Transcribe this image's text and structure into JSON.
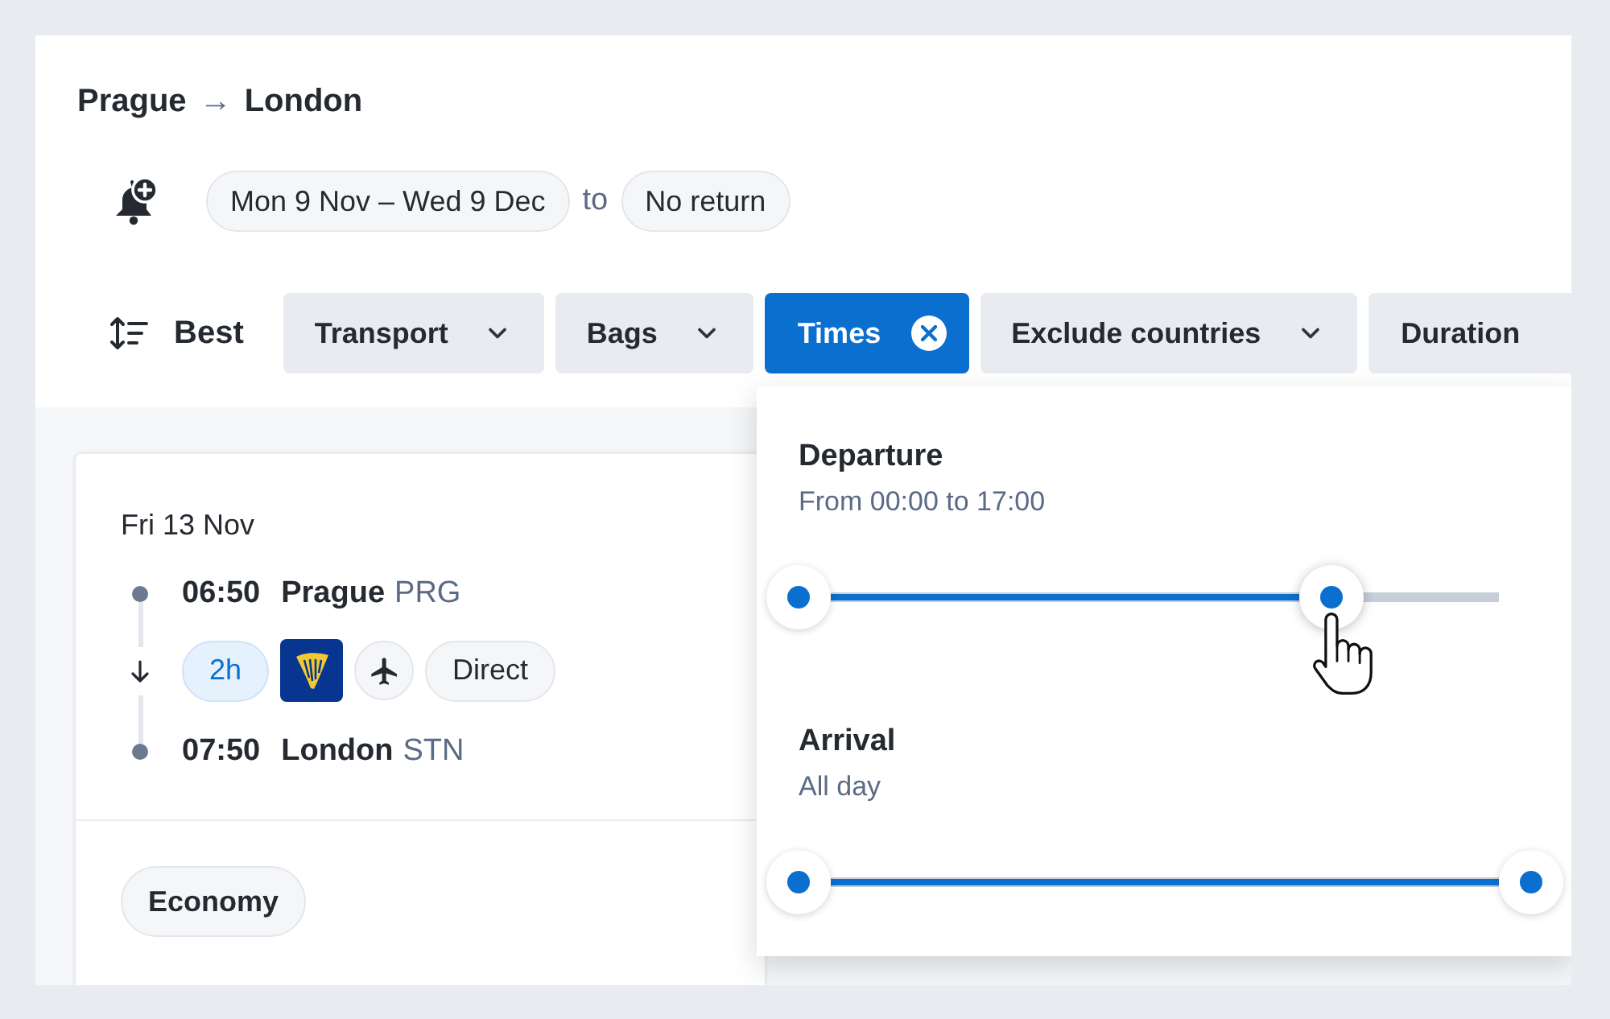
{
  "route": {
    "from": "Prague",
    "arrow": "→",
    "to": "London"
  },
  "dates": {
    "departure": "Mon 9 Nov – Wed 9 Dec",
    "connector": "to",
    "return": "No return"
  },
  "sort": {
    "label": "Best"
  },
  "filters": [
    {
      "label": "Transport",
      "kind": "dropdown",
      "selected": false
    },
    {
      "label": "Bags",
      "kind": "dropdown",
      "selected": false
    },
    {
      "label": "Times",
      "kind": "clearable",
      "selected": true
    },
    {
      "label": "Exclude countries",
      "kind": "dropdown",
      "selected": false
    },
    {
      "label": "Duration",
      "kind": "plain",
      "selected": false
    }
  ],
  "time_popup": {
    "sections": [
      {
        "title": "Departure",
        "subtitle": "From 00:00 to 17:00",
        "level": 0.7,
        "handles": [
          {
            "hovered": false
          },
          {
            "hovered": true
          }
        ]
      },
      {
        "title": "Arrival",
        "subtitle": "All day",
        "level": 1,
        "handles": [
          {
            "hovered": false
          },
          {
            "hovered": false
          }
        ]
      }
    ]
  },
  "result": {
    "date": "Fri 13 Nov",
    "departure": {
      "time": "06:50",
      "city": "Prague",
      "code": "PRG"
    },
    "duration": "2h",
    "stops": "Direct",
    "arrival": {
      "time": "07:50",
      "city": "London",
      "code": "STN"
    },
    "fare_class": "Economy"
  }
}
